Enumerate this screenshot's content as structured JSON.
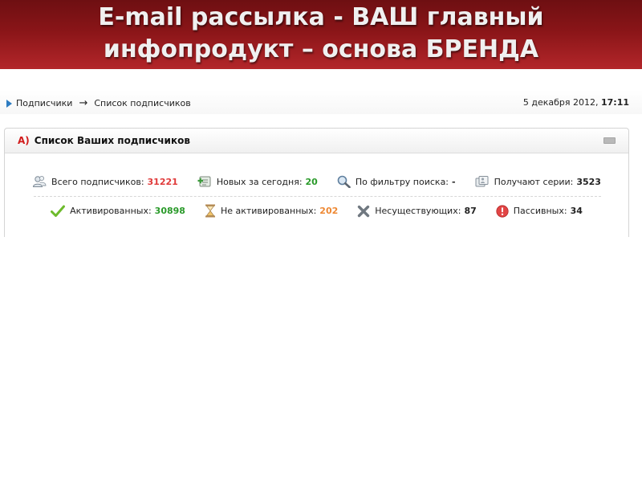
{
  "banner": {
    "line1": "E-mail рассылка - ВАШ главный",
    "line2": "инфопродукт – основа БРЕНДА"
  },
  "breadcrumb": {
    "items": [
      "Подписчики",
      "Список подписчиков"
    ],
    "separator": "→"
  },
  "datetime": {
    "date": "5 декабря 2012,",
    "time": "17:11"
  },
  "panel": {
    "letter": "А)",
    "title": "Список Ваших подписчиков"
  },
  "stats": {
    "total": {
      "label": "Всего подписчиков:",
      "value": "31221",
      "icon": "users-icon"
    },
    "new_today": {
      "label": "Новых за сегодня:",
      "value": "20",
      "icon": "add-user-icon"
    },
    "by_filter": {
      "label": "По фильтру поиска:",
      "value": "-",
      "icon": "magnifier-icon"
    },
    "series": {
      "label": "Получают серии:",
      "value": "3523",
      "icon": "series-icon"
    },
    "activated": {
      "label": "Активированных:",
      "value": "30898",
      "icon": "checkmark-icon"
    },
    "not_activated": {
      "label": "Не активированных:",
      "value": "202",
      "icon": "hourglass-icon"
    },
    "nonexistent": {
      "label": "Несуществующих:",
      "value": "87",
      "icon": "cross-icon"
    },
    "passive": {
      "label": "Пассивных:",
      "value": "34",
      "icon": "alert-icon"
    }
  },
  "colors": {
    "banner": "#8a1518",
    "accent_red": "#d11a1a",
    "value_red": "#e03a3a",
    "value_green": "#2a9a2a",
    "value_orange": "#ee8833"
  }
}
